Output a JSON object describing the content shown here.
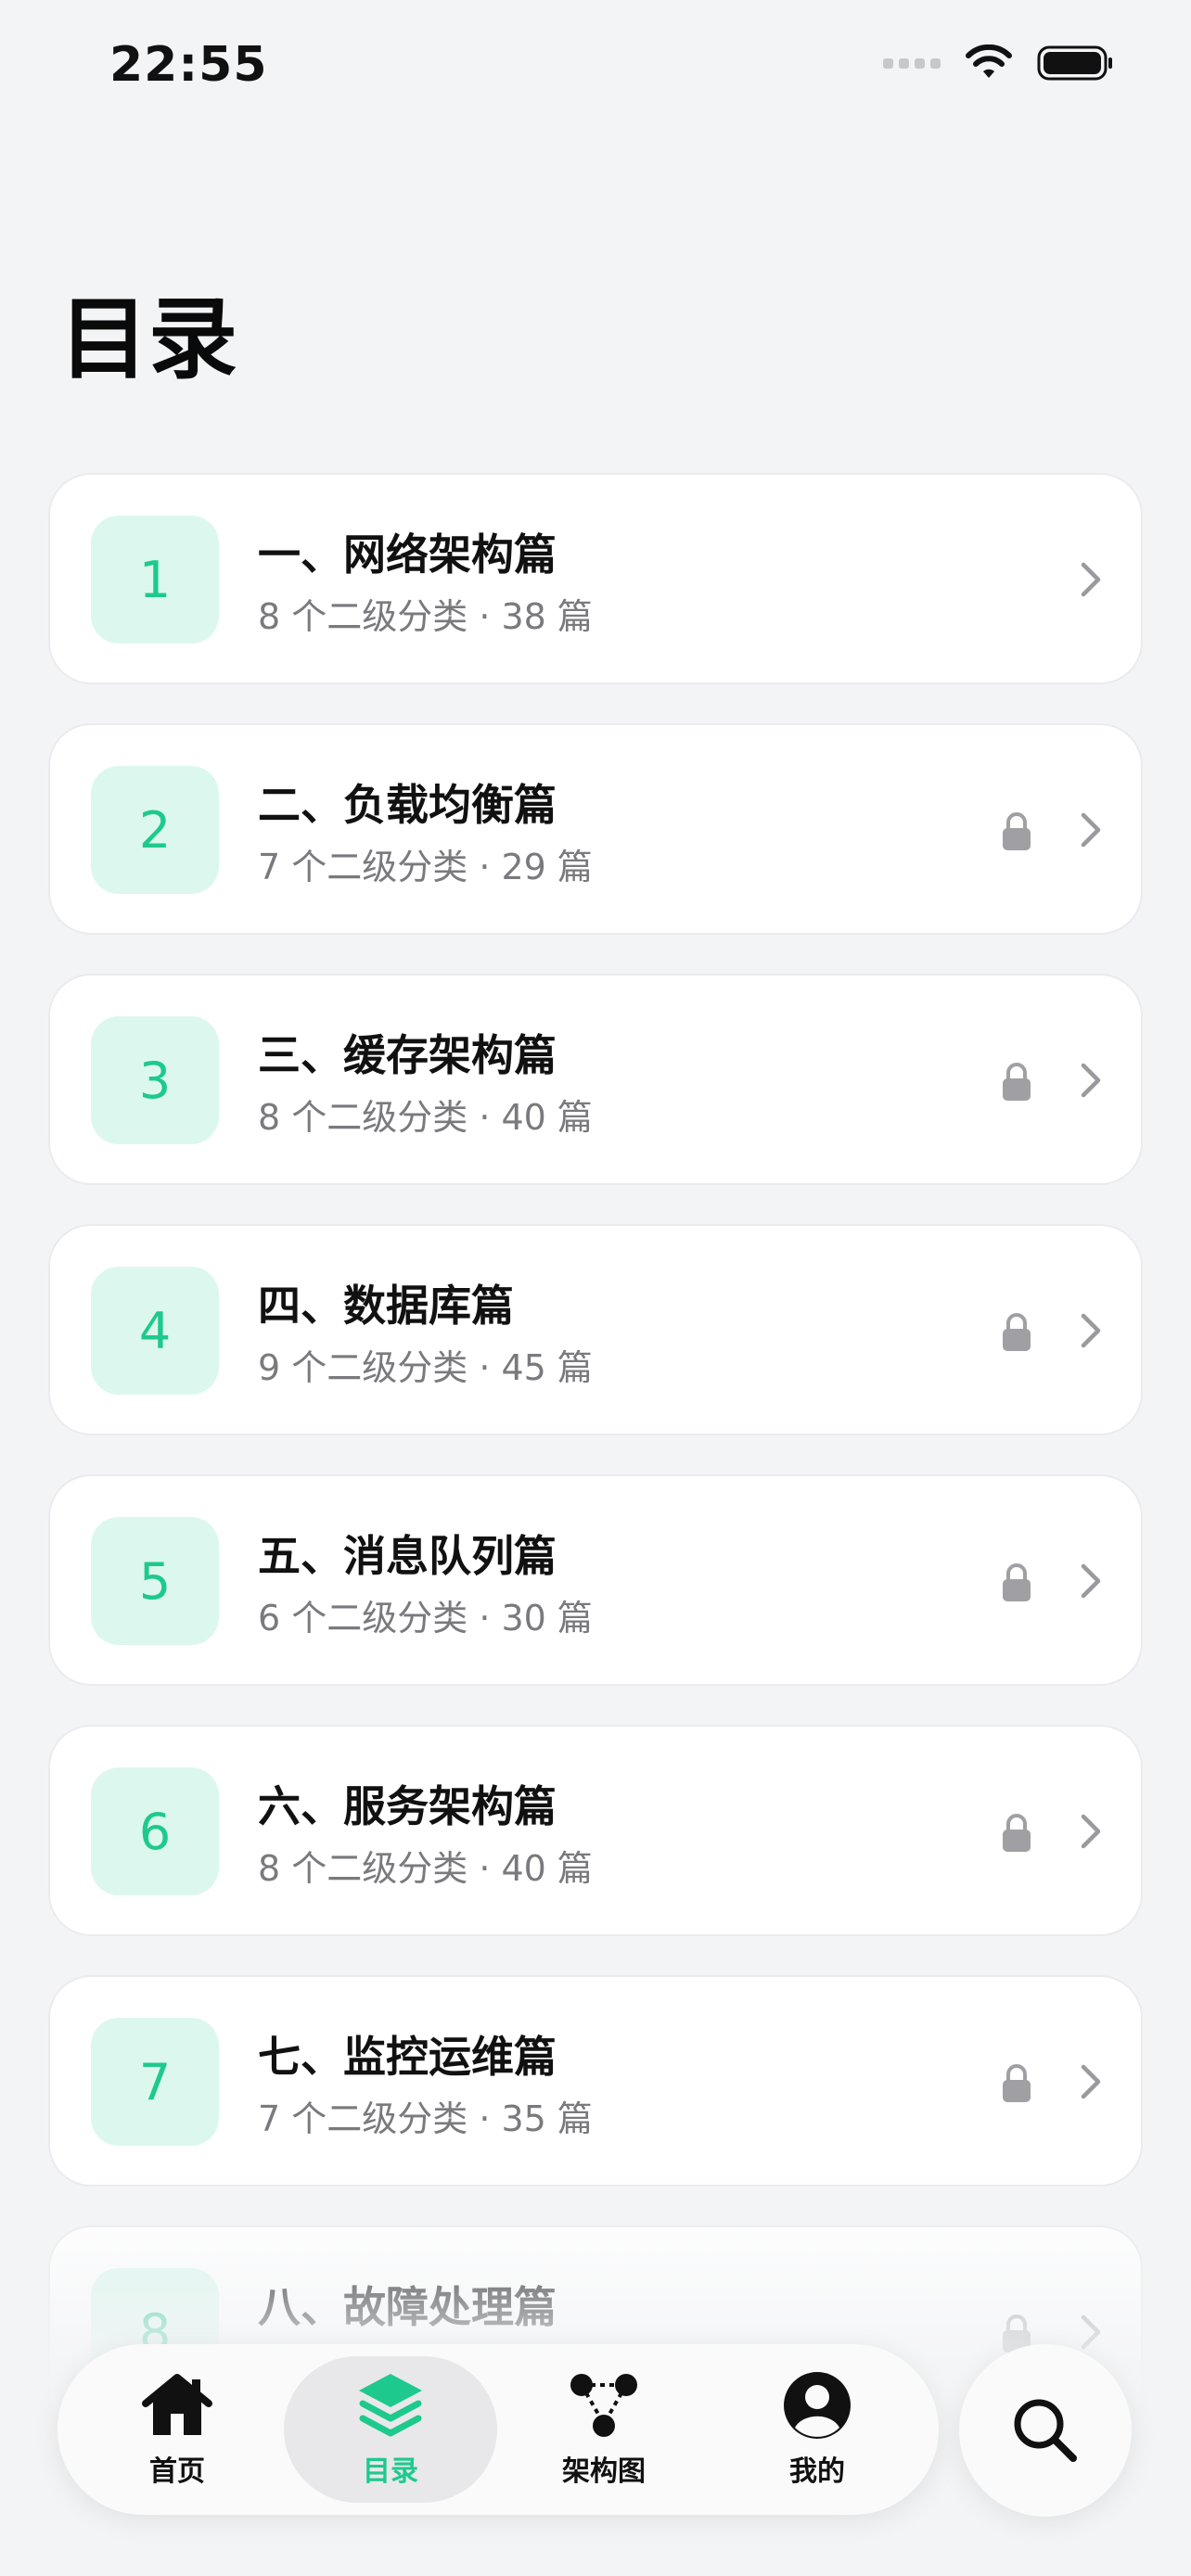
{
  "status_bar": {
    "time": "22:55"
  },
  "page": {
    "title": "目录"
  },
  "chapters": [
    {
      "number": "1",
      "title": "一、网络架构篇",
      "meta": "8 个二级分类 · 38 篇",
      "locked": false
    },
    {
      "number": "2",
      "title": "二、负载均衡篇",
      "meta": "7 个二级分类 · 29 篇",
      "locked": true
    },
    {
      "number": "3",
      "title": "三、缓存架构篇",
      "meta": "8 个二级分类 · 40 篇",
      "locked": true
    },
    {
      "number": "4",
      "title": "四、数据库篇",
      "meta": "9 个二级分类 · 45 篇",
      "locked": true
    },
    {
      "number": "5",
      "title": "五、消息队列篇",
      "meta": "6 个二级分类 · 30 篇",
      "locked": true
    },
    {
      "number": "6",
      "title": "六、服务架构篇",
      "meta": "8 个二级分类 · 40 篇",
      "locked": true
    },
    {
      "number": "7",
      "title": "七、监控运维篇",
      "meta": "7 个二级分类 · 35 篇",
      "locked": true
    },
    {
      "number": "8",
      "title": "八、故障处理篇",
      "meta": "",
      "locked": true
    }
  ],
  "tab_bar": {
    "items": [
      {
        "label": "首页",
        "icon": "home-icon",
        "active": false
      },
      {
        "label": "目录",
        "icon": "layers-icon",
        "active": true
      },
      {
        "label": "架构图",
        "icon": "diagram-icon",
        "active": false
      },
      {
        "label": "我的",
        "icon": "profile-icon",
        "active": false
      }
    ]
  },
  "search": {
    "icon": "search-icon"
  },
  "colors": {
    "accent": "#1ec98d",
    "badge_bg": "#dcf8ee",
    "background": "#f3f4f6"
  }
}
